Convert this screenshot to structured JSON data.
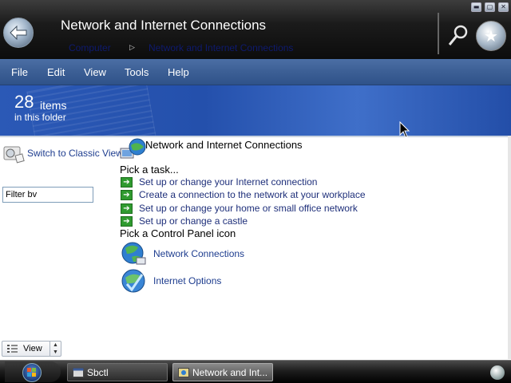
{
  "window": {
    "title": "Network and Internet Connections",
    "breadcrumb": [
      "Computer",
      "Network and Internet Connections"
    ],
    "controls": [
      "minimize",
      "maximize",
      "close"
    ]
  },
  "menu": {
    "items": [
      "File",
      "Edit",
      "View",
      "Tools",
      "Help"
    ]
  },
  "folder_info": {
    "count": "28",
    "count_label": "items",
    "subtitle": "in this folder"
  },
  "left_pane": {
    "classic_view_label": "Switch to Classic View",
    "filter_value": "Filter bv",
    "view_label": "View"
  },
  "category": {
    "title": "Network and Internet Connections",
    "pick_task_label": "Pick a task...",
    "tasks": [
      "Set up or change your Internet connection",
      "Create a connection to the network at your workplace",
      "Set up or change your home or small office network",
      "Set up or change a castle"
    ],
    "pick_icon_label": "Pick a Control Panel icon",
    "icons": [
      {
        "label": "Network Connections",
        "icon": "network-globe-icon"
      },
      {
        "label": "Internet Options",
        "icon": "internet-options-icon"
      }
    ]
  },
  "taskbar": {
    "items": [
      {
        "label": "Sbctl",
        "active": false
      },
      {
        "label": "Network and Int...",
        "active": true
      }
    ]
  },
  "colors": {
    "menu_bar": "#3c5f95",
    "info_band": "#2450ac",
    "task_arrow": "#2f9a2f",
    "link": "#1e3d8f"
  }
}
